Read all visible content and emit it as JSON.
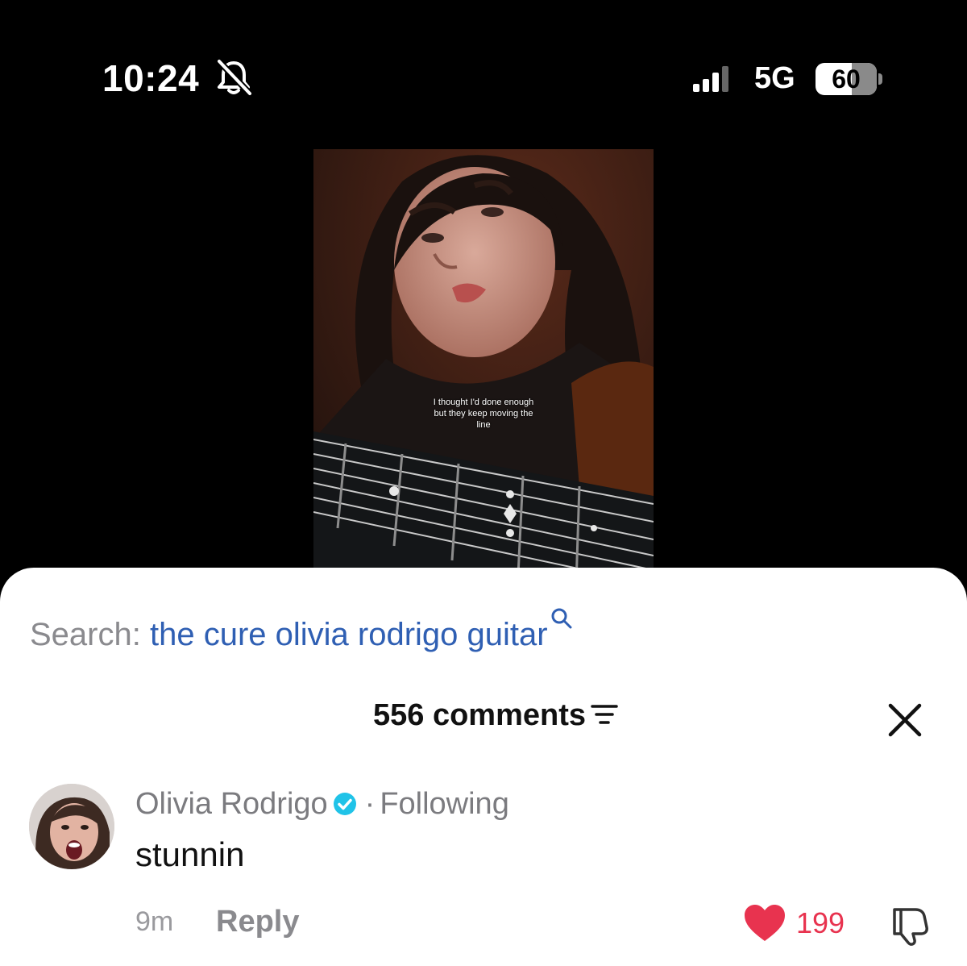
{
  "status_bar": {
    "time": "10:24",
    "network": "5G",
    "battery": "60",
    "battery_level_percent": 60,
    "icons": [
      "bell-muted-icon",
      "signal-icon"
    ]
  },
  "video": {
    "caption": "I thought I'd done enough but they keep moving the line"
  },
  "search": {
    "prefix": "Search:",
    "query": "the cure olivia rodrigo guitar",
    "icon": "search-icon",
    "color": "#2f5fb3"
  },
  "comments": {
    "title": "556 comments",
    "sort_icon": "sort-icon",
    "close_icon": "close-icon"
  },
  "comment": {
    "author": "Olivia Rodrigo",
    "relation": "Following",
    "separator": "·",
    "text": "stunnin",
    "time": "9m",
    "reply_label": "Reply",
    "likes": "199",
    "like_color": "#e8334f",
    "verified_color": "#20c3e8"
  }
}
